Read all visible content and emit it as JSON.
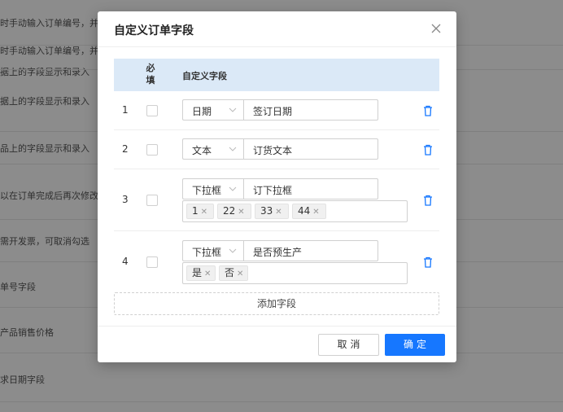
{
  "background": {
    "rows": [
      {
        "text": "时手动输入订单编号，并"
      },
      {
        "text": "据上的字段显示和录入"
      },
      {
        "text": "品上的字段显示和录入"
      },
      {
        "text": "以在订单完成后再次修改"
      },
      {
        "text": "需开发票，可取消勾选"
      },
      {
        "text": "单号字段"
      },
      {
        "text": "产品销售价格"
      },
      {
        "text": "求日期字段"
      }
    ]
  },
  "modal": {
    "title": "自定义订单字段",
    "close_icon": "close-icon",
    "table_headers": {
      "required": "必填",
      "field": "自定义字段"
    },
    "rows": [
      {
        "num": "1",
        "required": false,
        "type": "日期",
        "name": "签订日期",
        "options": []
      },
      {
        "num": "2",
        "required": false,
        "type": "文本",
        "name": "订货文本",
        "options": []
      },
      {
        "num": "3",
        "required": false,
        "type": "下拉框",
        "name": "订下拉框",
        "options": [
          "1",
          "22",
          "33",
          "44"
        ]
      },
      {
        "num": "4",
        "required": false,
        "type": "下拉框",
        "name": "是否预生产",
        "options": [
          "是",
          "否"
        ]
      }
    ],
    "add_field_label": "添加字段",
    "cancel_label": "取消",
    "ok_label": "确定"
  },
  "colors": {
    "primary": "#1677ff",
    "header_bg": "#dbe9f7",
    "overlay": "rgba(0,0,0,0.45)"
  }
}
